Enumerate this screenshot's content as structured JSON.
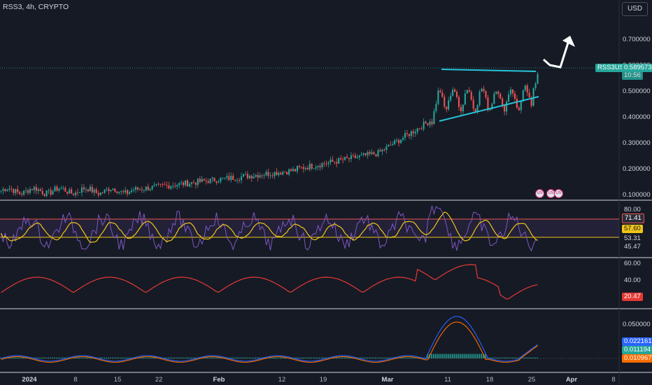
{
  "header": {
    "title": "RSS3, 4h, CRYPTO",
    "currency_button": "USD"
  },
  "price_axis": {
    "ticks": [
      "0.700000",
      "0.600000",
      "0.500000",
      "0.400000",
      "0.300000",
      "0.200000",
      "0.100000"
    ],
    "symbol_tag": "RSS3USD",
    "last_price": "0.589573",
    "countdown": "10:56"
  },
  "rsi_axis": {
    "ticks": [
      "80.00",
      "71.41",
      "57.60",
      "53.31",
      "45.47"
    ]
  },
  "adx_axis": {
    "ticks": [
      "60.00",
      "40.00",
      "20.47"
    ]
  },
  "macd_axis": {
    "ticks": [
      "0.050000",
      "0.022161",
      "0.011194",
      "0.010967"
    ]
  },
  "x_axis": {
    "labels": [
      "2024",
      "8",
      "15",
      "22",
      "Feb",
      "12",
      "19",
      "Mar",
      "11",
      "18",
      "25",
      "Apr",
      "8"
    ]
  },
  "colors": {
    "bg": "#161a25",
    "up": "#26a69a",
    "down": "#ef5350",
    "rsi": "#7e57c2",
    "rsi_ma": "#f0c419",
    "adx": "#e53935",
    "macd": "#2962ff",
    "signal": "#ff6d00",
    "trend": "#26c6da",
    "last": "#26a69a"
  }
}
